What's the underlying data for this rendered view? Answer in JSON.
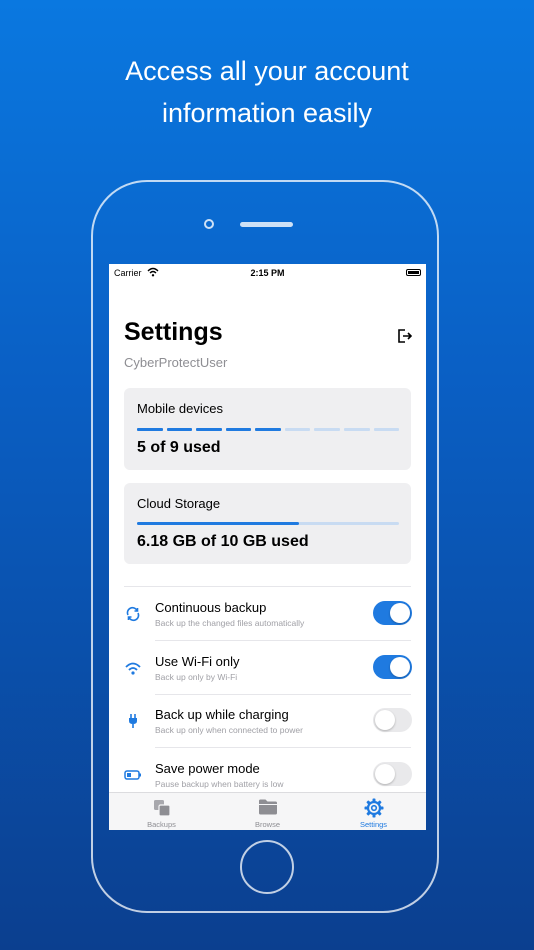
{
  "headline": {
    "line1": "Access all your account",
    "line2": "information easily"
  },
  "status_bar": {
    "carrier": "Carrier",
    "time": "2:15 PM"
  },
  "header": {
    "title": "Settings",
    "username": "CyberProtectUser",
    "logout_icon": "logout-icon"
  },
  "mobile_devices": {
    "label": "Mobile devices",
    "usage": "5 of 9 used",
    "used": 5,
    "total": 9
  },
  "cloud_storage": {
    "label": "Cloud Storage",
    "usage": "6.18 GB of 10 GB used",
    "fraction": 0.618
  },
  "settings": [
    {
      "icon": "sync-icon",
      "title": "Continuous backup",
      "subtitle": "Back up the changed files automatically",
      "on": true
    },
    {
      "icon": "wifi-icon",
      "title": "Use Wi-Fi only",
      "subtitle": "Back up only by Wi-Fi",
      "on": true
    },
    {
      "icon": "plug-icon",
      "title": "Back up while charging",
      "subtitle": "Back up only when connected to power",
      "on": false
    },
    {
      "icon": "battery-icon",
      "title": "Save power mode",
      "subtitle": "Pause backup when battery is low",
      "on": false
    }
  ],
  "tabs": [
    {
      "icon": "backups-icon",
      "label": "Backups",
      "active": false
    },
    {
      "icon": "folder-icon",
      "label": "Browse",
      "active": false
    },
    {
      "icon": "gear-icon",
      "label": "Settings",
      "active": true
    }
  ],
  "colors": {
    "accent": "#1f7ae0",
    "segment_inactive": "#c8dbf2",
    "background_top": "#0a78e0",
    "background_bottom": "#0b3f8f"
  }
}
